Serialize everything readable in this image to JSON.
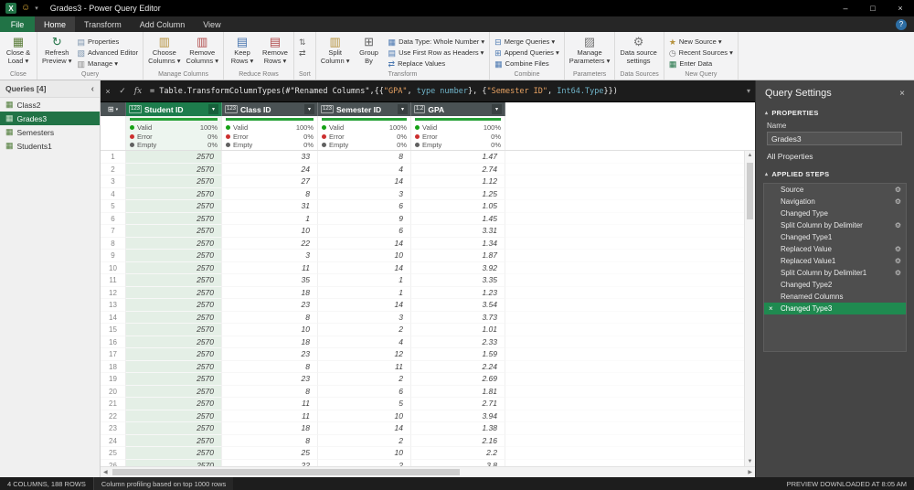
{
  "window": {
    "title": "Grades3 - Power Query Editor",
    "icons": {
      "excel": "X",
      "smiley": "☺",
      "caret": "▾"
    },
    "controls": {
      "minimize": "–",
      "maximize": "□",
      "close": "×"
    }
  },
  "tabs": {
    "file": "File",
    "items": [
      "Home",
      "Transform",
      "Add Column",
      "View"
    ],
    "active": "Home",
    "help": "?"
  },
  "ribbon": {
    "groups": [
      {
        "label": "Close",
        "big": [
          {
            "icon": "close-load",
            "label": "Close &\nLoad ▾"
          }
        ]
      },
      {
        "label": "Query",
        "big": [
          {
            "icon": "refresh",
            "label": "Refresh\nPreview ▾"
          }
        ],
        "stack": [
          {
            "icon": "properties",
            "label": "Properties"
          },
          {
            "icon": "advanced",
            "label": "Advanced Editor"
          },
          {
            "icon": "manage",
            "label": "Manage ▾"
          }
        ]
      },
      {
        "label": "Manage Columns",
        "big": [
          {
            "icon": "choose-columns",
            "label": "Choose\nColumns ▾"
          },
          {
            "icon": "remove-columns",
            "label": "Remove\nColumns ▾"
          }
        ]
      },
      {
        "label": "Reduce Rows",
        "big": [
          {
            "icon": "keep-rows",
            "label": "Keep\nRows ▾"
          },
          {
            "icon": "remove-rows",
            "label": "Remove\nRows ▾"
          }
        ]
      },
      {
        "label": "Sort",
        "stack": [
          {
            "icon": "sort-az"
          },
          {
            "icon": "sort-za"
          }
        ]
      },
      {
        "label": "Transform",
        "big": [
          {
            "icon": "split-column",
            "label": "Split\nColumn ▾"
          },
          {
            "icon": "group-by",
            "label": "Group\nBy"
          }
        ],
        "stack": [
          {
            "icon": "data-type",
            "label": "Data Type: Whole Number ▾"
          },
          {
            "icon": "first-row",
            "label": "Use First Row as Headers ▾"
          },
          {
            "icon": "replace-values",
            "label": "Replace Values"
          }
        ]
      },
      {
        "label": "Combine",
        "stack": [
          {
            "icon": "merge",
            "label": "Merge Queries ▾"
          },
          {
            "icon": "append",
            "label": "Append Queries ▾"
          },
          {
            "icon": "combine-files",
            "label": "Combine Files"
          }
        ]
      },
      {
        "label": "Parameters",
        "big": [
          {
            "icon": "parameters",
            "label": "Manage\nParameters ▾"
          }
        ]
      },
      {
        "label": "Data Sources",
        "big": [
          {
            "icon": "data-source",
            "label": "Data source\nsettings"
          }
        ]
      },
      {
        "label": "New Query",
        "stack": [
          {
            "icon": "new-source",
            "label": "New Source ▾"
          },
          {
            "icon": "recent-sources",
            "label": "Recent Sources ▾"
          },
          {
            "icon": "enter-data",
            "label": "Enter Data"
          }
        ]
      }
    ]
  },
  "formula": {
    "cancel": "×",
    "accept": "✓",
    "fx": "fx",
    "expand": "▾",
    "segments": [
      {
        "t": "= Table.TransformColumnTypes(#\"Renamed Columns\",{{",
        "c": "plain"
      },
      {
        "t": "\"GPA\"",
        "c": "string"
      },
      {
        "t": ", ",
        "c": "plain"
      },
      {
        "t": "type number",
        "c": "keyword"
      },
      {
        "t": "}, {",
        "c": "plain"
      },
      {
        "t": "\"Semester ID\"",
        "c": "string"
      },
      {
        "t": ", ",
        "c": "plain"
      },
      {
        "t": "Int64.Type",
        "c": "keyword"
      },
      {
        "t": "}})",
        "c": "plain"
      }
    ]
  },
  "queries": {
    "header": "Queries [4]",
    "collapse": "‹",
    "item_icon": "▦",
    "items": [
      {
        "name": "Class2"
      },
      {
        "name": "Grades3",
        "selected": true
      },
      {
        "name": "Semesters"
      },
      {
        "name": "Students1"
      }
    ]
  },
  "grid": {
    "corner_icon": "⊞",
    "corner_caret": "▾",
    "filter_icon": "▾",
    "quality_labels": {
      "valid": "Valid",
      "error": "Error",
      "empty": "Empty"
    },
    "columns": [
      {
        "type_icon": "123",
        "name": "Student ID",
        "selected": true,
        "valid": "100%",
        "error": "0%",
        "empty": "0%"
      },
      {
        "type_icon": "123",
        "name": "Class ID",
        "valid": "100%",
        "error": "0%",
        "empty": "0%"
      },
      {
        "type_icon": "123",
        "name": "Semester ID",
        "valid": "100%",
        "error": "0%",
        "empty": "0%"
      },
      {
        "type_icon": "1.2",
        "name": "GPA",
        "valid": "100%",
        "error": "0%",
        "empty": "0%"
      }
    ],
    "rows": [
      [
        "2570",
        "33",
        "8",
        "1.47"
      ],
      [
        "2570",
        "24",
        "4",
        "2.74"
      ],
      [
        "2570",
        "27",
        "14",
        "1.12"
      ],
      [
        "2570",
        "8",
        "3",
        "1.25"
      ],
      [
        "2570",
        "31",
        "6",
        "1.05"
      ],
      [
        "2570",
        "1",
        "9",
        "1.45"
      ],
      [
        "2570",
        "10",
        "6",
        "3.31"
      ],
      [
        "2570",
        "22",
        "14",
        "1.34"
      ],
      [
        "2570",
        "3",
        "10",
        "1.87"
      ],
      [
        "2570",
        "11",
        "14",
        "3.92"
      ],
      [
        "2570",
        "35",
        "1",
        "3.35"
      ],
      [
        "2570",
        "18",
        "1",
        "1.23"
      ],
      [
        "2570",
        "23",
        "14",
        "3.54"
      ],
      [
        "2570",
        "8",
        "3",
        "3.73"
      ],
      [
        "2570",
        "10",
        "2",
        "1.01"
      ],
      [
        "2570",
        "18",
        "4",
        "2.33"
      ],
      [
        "2570",
        "23",
        "12",
        "1.59"
      ],
      [
        "2570",
        "8",
        "11",
        "2.24"
      ],
      [
        "2570",
        "23",
        "2",
        "2.69"
      ],
      [
        "2570",
        "8",
        "6",
        "1.81"
      ],
      [
        "2570",
        "11",
        "5",
        "2.71"
      ],
      [
        "2570",
        "11",
        "10",
        "3.94"
      ],
      [
        "2570",
        "18",
        "14",
        "1.38"
      ],
      [
        "2570",
        "8",
        "2",
        "2.16"
      ],
      [
        "2570",
        "25",
        "10",
        "2.2"
      ],
      [
        "2570",
        "22",
        "2",
        "3.8"
      ]
    ]
  },
  "scrollbars": {
    "up": "▲",
    "down": "▼",
    "left": "◀",
    "right": "▶"
  },
  "settings": {
    "title": "Query Settings",
    "close": "×",
    "section_marker": "▴",
    "properties_header": "PROPERTIES",
    "name_label": "Name",
    "name_value": "Grades3",
    "all_properties": "All Properties",
    "applied_header": "APPLIED STEPS",
    "gear_icon": "⚙",
    "delete_icon": "×",
    "steps": [
      {
        "name": "Source",
        "gear": true
      },
      {
        "name": "Navigation",
        "gear": true
      },
      {
        "name": "Changed Type"
      },
      {
        "name": "Split Column by Delimiter",
        "gear": true
      },
      {
        "name": "Changed Type1"
      },
      {
        "name": "Replaced Value",
        "gear": true
      },
      {
        "name": "Replaced Value1",
        "gear": true
      },
      {
        "name": "Split Column by Delimiter1",
        "gear": true
      },
      {
        "name": "Changed Type2"
      },
      {
        "name": "Renamed Columns"
      },
      {
        "name": "Changed Type3",
        "selected": true
      }
    ]
  },
  "status": {
    "left_primary": "4 COLUMNS, 188 ROWS",
    "left_secondary": "Column profiling based on top 1000 rows",
    "right": "PREVIEW DOWNLOADED AT 8:05 AM"
  }
}
